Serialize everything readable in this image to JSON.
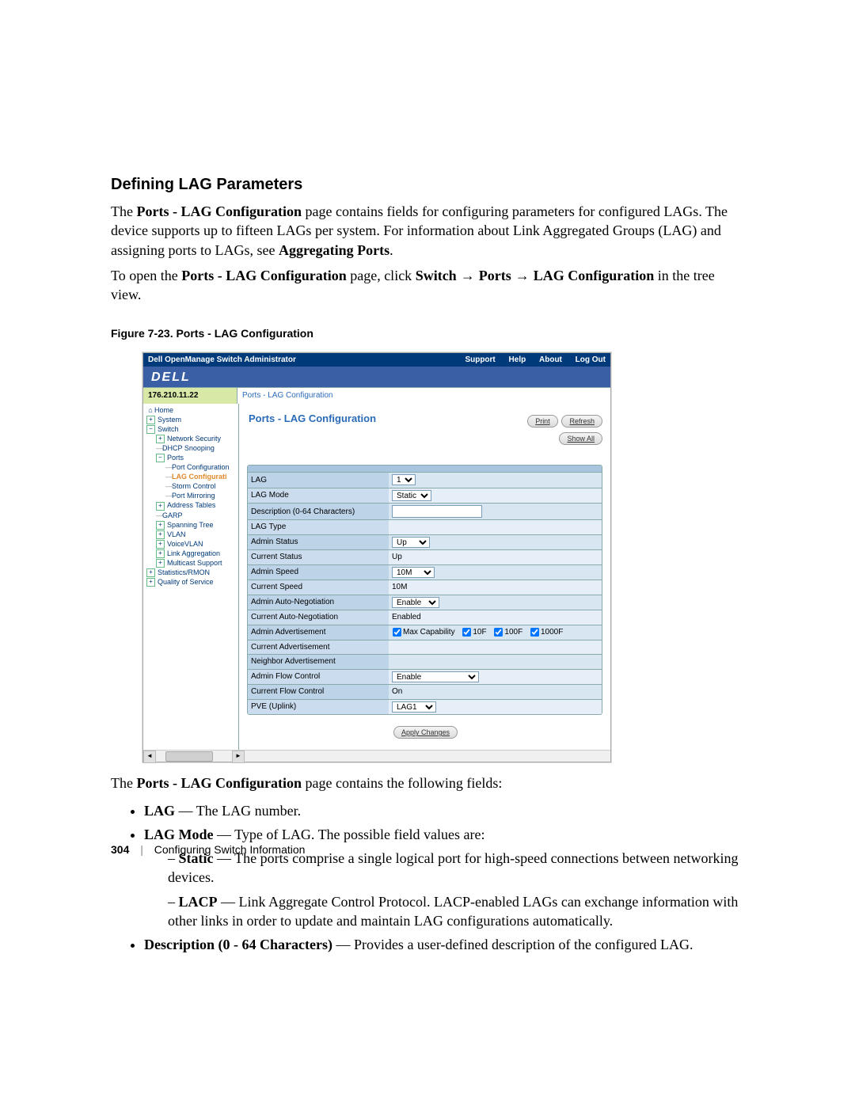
{
  "page": {
    "heading": "Defining LAG Parameters",
    "p1_a": "The ",
    "p1_b1": "Ports - LAG Configuration",
    "p1_c": " page contains fields for configuring parameters for configured LAGs. The device supports up to fifteen LAGs per system. For information about Link Aggregated Groups (LAG) and assigning ports to LAGs, see ",
    "p1_b2": "Aggregating Ports",
    "p1_d": ".",
    "p2_a": "To open the ",
    "p2_b1": "Ports - LAG Configuration",
    "p2_c": " page, click ",
    "p2_b2": "Switch",
    "p2_b3": "Ports",
    "p2_b4": "LAG Configuration",
    "p2_d": " in the tree view.",
    "figure_label": "Figure 7-23.    Ports - LAG Configuration",
    "post_intro": "The Ports - LAG Configuration page contains the following fields:",
    "post_intro_b": "Ports - LAG Configuration",
    "li_lag_b": "LAG",
    "li_lag_t": " — The LAG number.",
    "li_mode_b": "LAG Mode",
    "li_mode_t": " — Type of LAG. The possible field values are:",
    "li_static_b": "Static",
    "li_static_t": " — The ports comprise a single logical port for high-speed connections between networking devices.",
    "li_lacp_b": "LACP",
    "li_lacp_t": " — Link Aggregate Control Protocol. LACP-enabled LAGs can exchange information with other links in order to update and maintain LAG configurations automatically.",
    "li_desc_b": "Description (0 - 64 Characters)",
    "li_desc_t": " — Provides a user-defined description of the configured LAG.",
    "pagenum": "304",
    "chapter": "Configuring Switch Information"
  },
  "shot": {
    "topbar_title": "Dell OpenManage Switch Administrator",
    "links": {
      "support": "Support",
      "help": "Help",
      "about": "About",
      "logout": "Log Out"
    },
    "logo": "DELL",
    "ip": "176.210.11.22",
    "breadcrumb": "Ports - LAG Configuration",
    "panel_title": "Ports - LAG Configuration",
    "buttons": {
      "print": "Print",
      "refresh": "Refresh",
      "show_all": "Show All",
      "apply": "Apply Changes"
    },
    "tree": {
      "home": "Home",
      "system": "System",
      "switch": "Switch",
      "net_sec": "Network Security",
      "dhcp": "DHCP Snooping",
      "ports": "Ports",
      "port_conf": "Port Configuration",
      "lag_conf": "LAG Configurati",
      "storm": "Storm Control",
      "mirror": "Port Mirroring",
      "addr": "Address Tables",
      "garp": "GARP",
      "span": "Spanning Tree",
      "vlan": "VLAN",
      "voice": "VoiceVLAN",
      "linkagg": "Link Aggregation",
      "mcast": "Multicast Support",
      "stats": "Statistics/RMON",
      "qos": "Quality of Service"
    },
    "rows": {
      "lag": "LAG",
      "lag_mode": "LAG Mode",
      "desc": "Description (0-64 Characters)",
      "lag_type": "LAG Type",
      "admin_status": "Admin Status",
      "cur_status": "Current Status",
      "admin_speed": "Admin Speed",
      "cur_speed": "Current Speed",
      "admin_auto": "Admin Auto-Negotiation",
      "cur_auto": "Current Auto-Negotiation",
      "admin_adv": "Admin Advertisement",
      "cur_adv": "Current Advertisement",
      "neigh_adv": "Neighbor Advertisement",
      "admin_flow": "Admin Flow Control",
      "cur_flow": "Current Flow Control",
      "pve": "PVE (Uplink)"
    },
    "vals": {
      "lag": "1",
      "lag_mode": "Static",
      "admin_status": "Up",
      "cur_status": "Up",
      "admin_speed": "10M",
      "cur_speed": "10M",
      "admin_auto": "Enable",
      "cur_auto": "Enabled",
      "adv_max": "Max Capability",
      "adv_10f": "10F",
      "adv_100f": "100F",
      "adv_1000f": "1000F",
      "admin_flow": "Enable",
      "cur_flow": "On",
      "pve": "LAG1"
    }
  }
}
